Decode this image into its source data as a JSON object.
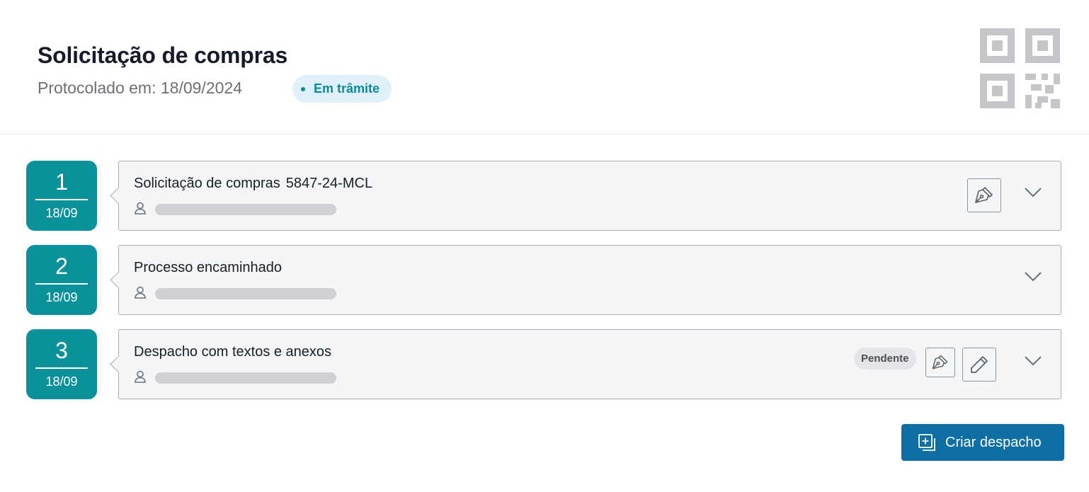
{
  "header": {
    "title": "Solicitação de compras",
    "subtitle": "Protocolado em: 18/09/2024",
    "status": "Em trâmite",
    "qr_icon": "qr-code-icon"
  },
  "steps": [
    {
      "number": "1",
      "date": "18/09",
      "title": "Solicitação de compras",
      "code": "5847-24-MCL",
      "actions": [
        "sign-icon",
        "chevron-down-icon"
      ]
    },
    {
      "number": "2",
      "date": "18/09",
      "title": "Processo encaminhado",
      "actions": [
        "chevron-down-icon"
      ]
    },
    {
      "number": "3",
      "date": "18/09",
      "title": "Despacho com textos e anexos",
      "badge": "Pendente",
      "actions": [
        "sign-icon",
        "pencil-icon",
        "chevron-down-icon"
      ]
    }
  ],
  "footer": {
    "create_label": "Criar despacho",
    "create_icon": "add-document-icon"
  },
  "colors": {
    "accent_teal": "#0a9199",
    "primary_blue": "#0d6ea3",
    "status_bg": "#e0f0fa",
    "card_bg": "#f4f5f7"
  }
}
